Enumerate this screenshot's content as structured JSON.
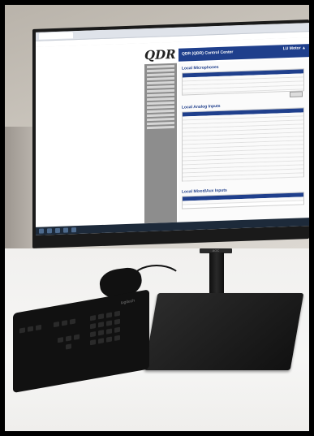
{
  "scene": "Monitor showing QDR Control Center web interface on a desk with keyboard",
  "screen": {
    "logo_text": "QDR",
    "header_title": "QDR (QDR) Control Center",
    "header_user": "LU Motor ▲",
    "sections": [
      {
        "title": "Local Microphones"
      },
      {
        "title": "Local Analog Inputs"
      },
      {
        "title": "Local Mixed/Aux Inputs"
      }
    ]
  },
  "monitor": {
    "brand": "AOC"
  },
  "keyboard": {
    "brand": "logitech"
  }
}
